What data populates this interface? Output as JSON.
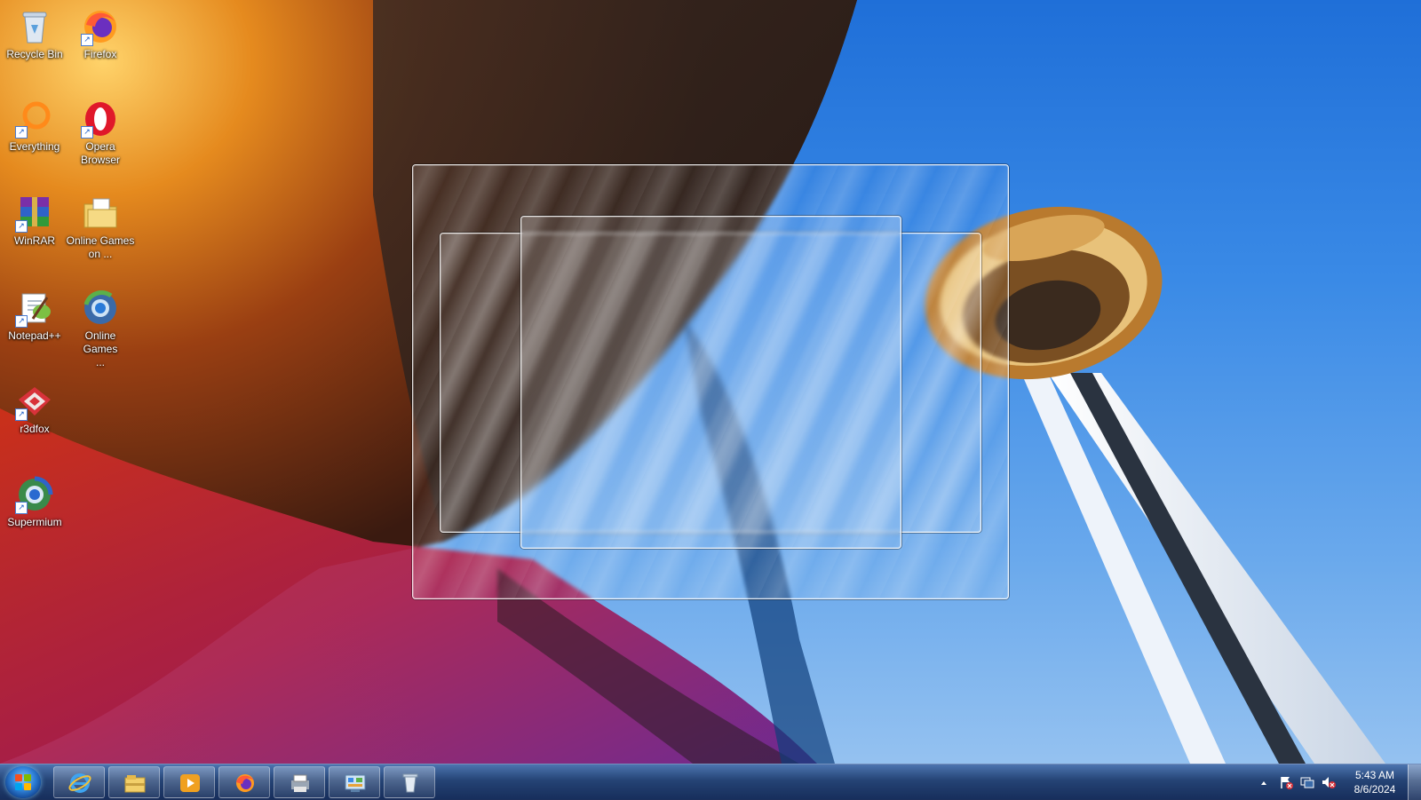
{
  "desktop": {
    "icons": [
      {
        "label": "Recycle Bin",
        "icon": "recycle-bin-icon"
      },
      {
        "label": "Firefox",
        "icon": "firefox-icon"
      },
      {
        "label": "Everything",
        "icon": "everything-search-icon"
      },
      {
        "label": "Opera Browser",
        "icon": "opera-icon"
      },
      {
        "label": "WinRAR",
        "icon": "winrar-icon"
      },
      {
        "label": "Online Games on ...",
        "icon": "folder-icon"
      },
      {
        "label": "Notepad++",
        "icon": "notepad-plus-plus-icon"
      },
      {
        "label": "Online Games ...",
        "icon": "globe-browser-icon"
      },
      {
        "label": "r3dfox",
        "icon": "r3dfox-icon"
      },
      {
        "label": "Supermium",
        "icon": "supermium-icon"
      }
    ]
  },
  "taskbar": {
    "pinned": [
      {
        "icon": "internet-explorer-icon"
      },
      {
        "icon": "file-explorer-icon"
      },
      {
        "icon": "media-player-icon"
      },
      {
        "icon": "firefox-icon"
      },
      {
        "icon": "devices-printers-icon"
      },
      {
        "icon": "control-panel-icon"
      },
      {
        "icon": "recycle-bin-icon"
      }
    ],
    "tray": {
      "icons": [
        "show-hidden-icons-arrow",
        "action-center-flag-icon",
        "network-icon",
        "volume-muted-icon"
      ]
    },
    "clock": {
      "time": "5:43 AM",
      "date": "8/6/2024"
    }
  },
  "colors": {
    "accent": "#2e7fd6",
    "sky": "#3a8ae6",
    "tower_orange": "#c8893a"
  }
}
